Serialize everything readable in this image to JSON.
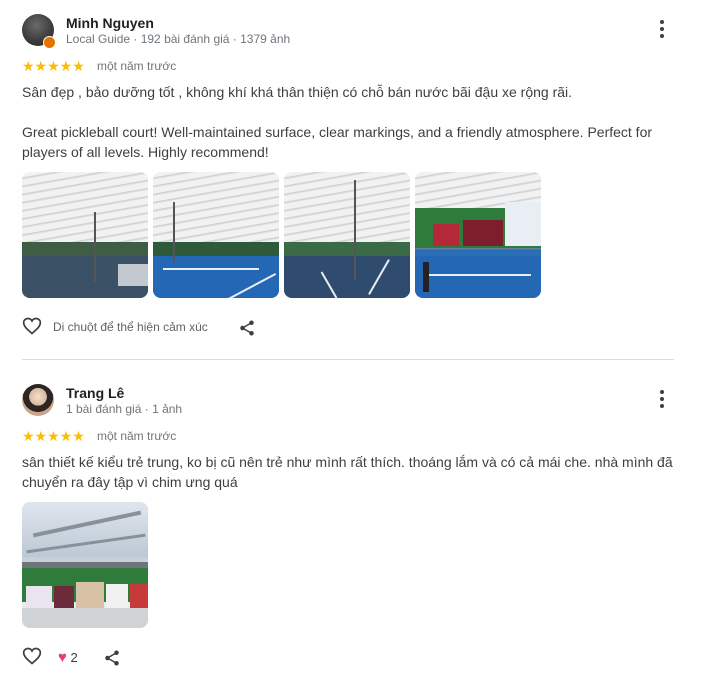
{
  "reviews": [
    {
      "author": "Minh Nguyen",
      "meta": "Local Guide · 192 bài đánh giá · 1379 ảnh",
      "stars": "★★★★★",
      "rating": 5,
      "when": "một năm trước",
      "text_vi": "Sân đẹp , bảo dưỡng tốt , không khí khá thân thiện có chỗ bán nước bãi đậu xe rộng rãi.",
      "text_en": "Great pickleball court! Well-maintained surface, clear markings, and a friendly atmosphere. Perfect for players of all levels. Highly recommend!",
      "photo_count": 4,
      "react_label": "Di chuột để thể hiện cảm xúc"
    },
    {
      "author": "Trang Lê",
      "meta": "1 bài đánh giá · 1 ảnh",
      "stars": "★★★★★",
      "rating": 5,
      "when": "một năm trước",
      "text": "sân thiết kế kiểu trẻ trung, ko bị cũ nên trẻ như mình rất thích. thoáng lắm và có cả mái che. nhà mình đã chuyển ra đây tập vì chim ưng quá",
      "photo_count": 1,
      "likes": "2"
    }
  ],
  "icons": {
    "more": "more-vert-icon",
    "heart": "heart-outline-icon",
    "share": "share-icon",
    "liked": "heart-filled-icon"
  },
  "colors": {
    "star": "#fbbc04",
    "liked_heart": "#e63f6b",
    "badge": "#e37400"
  }
}
